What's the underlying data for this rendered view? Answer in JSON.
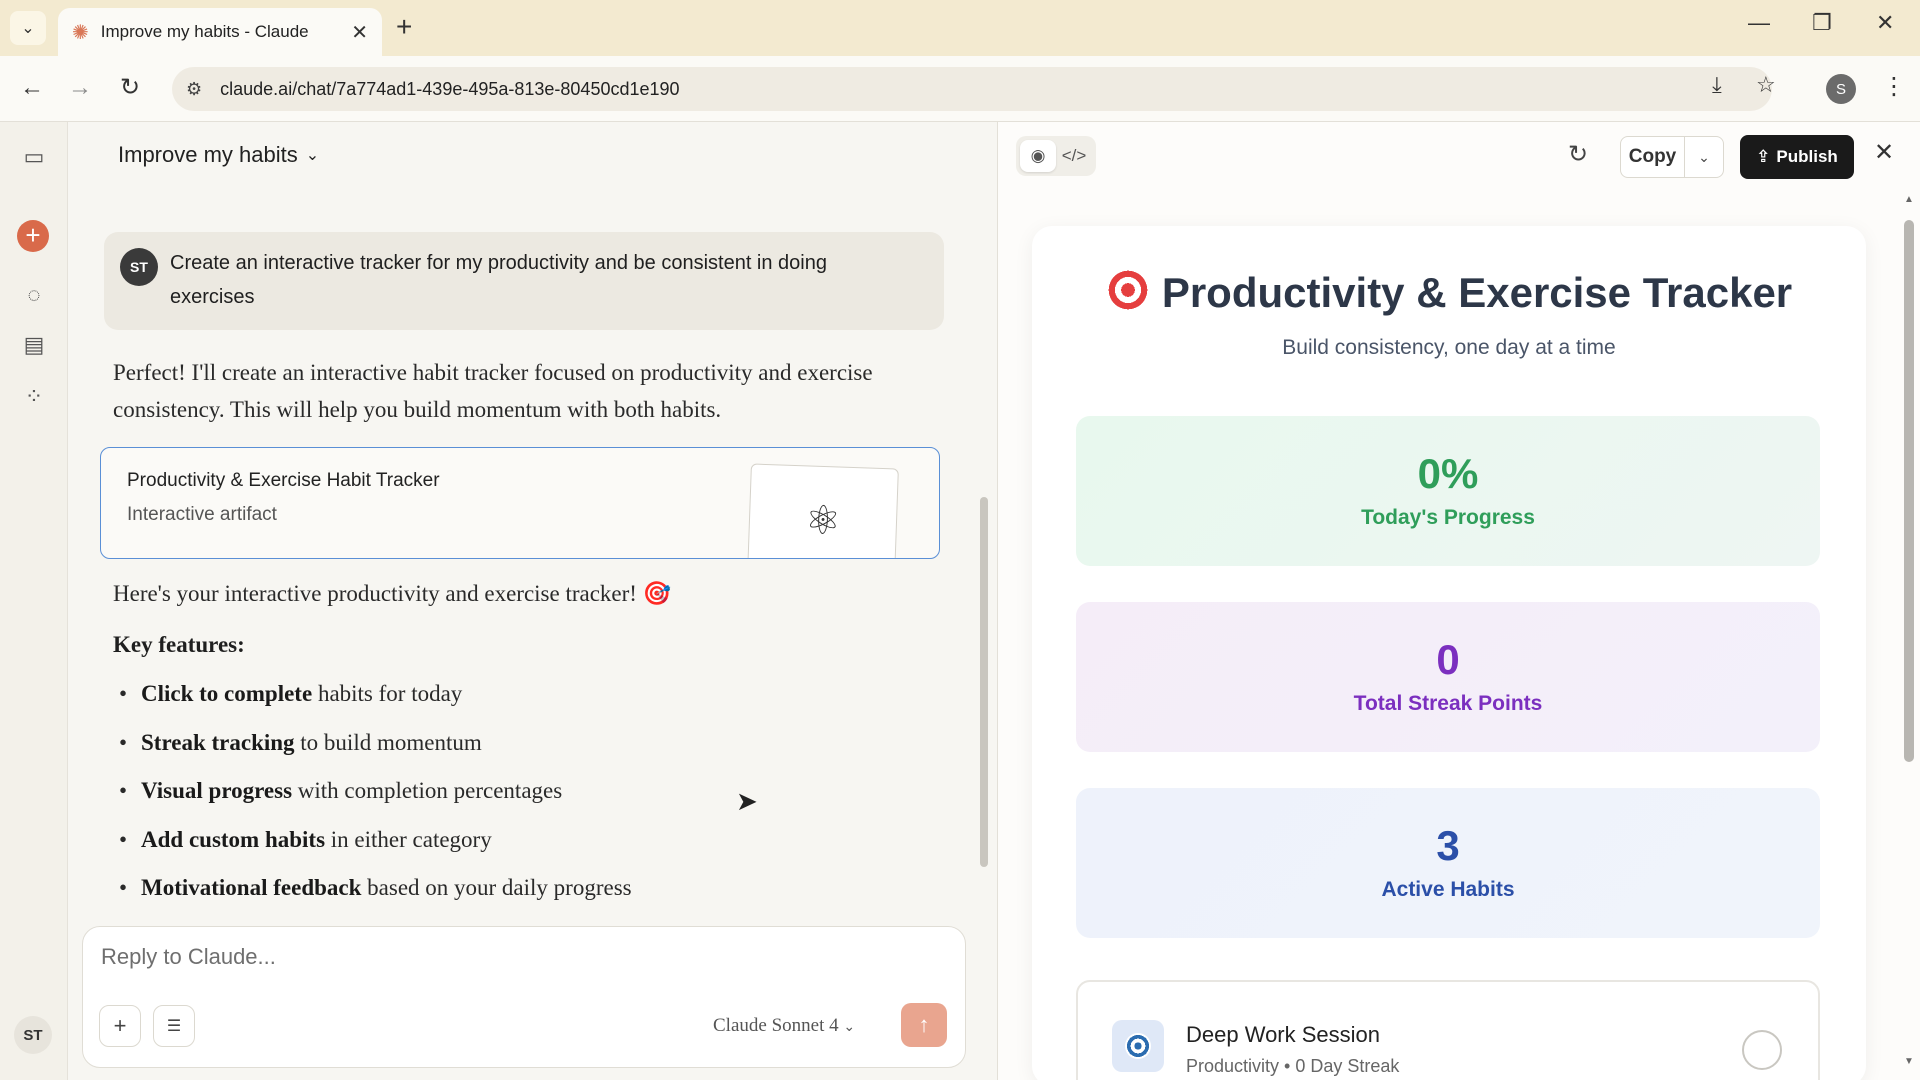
{
  "browser": {
    "tab_title": "Improve my habits - Claude",
    "tab_close": "✕",
    "new_tab": "+",
    "url": "claude.ai/chat/7a774ad1-439e-495a-813e-80450cd1e190",
    "profile_initial": "S"
  },
  "sidebar": {
    "avatar_initials": "ST"
  },
  "chat": {
    "title": "Improve my habits",
    "user_initials": "ST",
    "user_message": "Create an interactive tracker for my productivity and be consistent in doing exercises",
    "reply_intro": "Perfect! I'll create an interactive habit tracker focused on productivity and exercise consistency. This will help you build momentum with both habits.",
    "artifact_card": {
      "title": "Productivity & Exercise Habit Tracker",
      "subtitle": "Interactive artifact"
    },
    "reply_line": "Here's your interactive productivity and exercise tracker! 🎯",
    "key_features_heading": "Key features:",
    "features": [
      {
        "bold": "Click to complete",
        "rest": " habits for today"
      },
      {
        "bold": "Streak tracking",
        "rest": " to build momentum"
      },
      {
        "bold": "Visual progress",
        "rest": " with completion percentages"
      },
      {
        "bold": "Add custom habits",
        "rest": " in either category"
      },
      {
        "bold": "Motivational feedback",
        "rest": " based on your daily progress"
      }
    ],
    "composer": {
      "placeholder": "Reply to Claude...",
      "model": "Claude Sonnet 4"
    }
  },
  "artifact": {
    "toolbar": {
      "copy_label": "Copy",
      "publish_label": "Publish"
    },
    "app": {
      "title": "Productivity & Exercise Tracker",
      "subtitle": "Build consistency, one day at a time",
      "stats": [
        {
          "value": "0%",
          "label": "Today's Progress",
          "color": "#2f9e5a"
        },
        {
          "value": "0",
          "label": "Total Streak Points",
          "color": "#7b2fbf"
        },
        {
          "value": "3",
          "label": "Active Habits",
          "color": "#2b4fa8"
        }
      ],
      "habits": [
        {
          "name": "Deep Work Session",
          "meta": "Productivity • 0 Day Streak",
          "completed": false
        }
      ]
    }
  },
  "colors": {
    "accent": "#d96a4a",
    "artifact_border": "#5a8fd6",
    "publish_bg": "#1a1a1a"
  }
}
